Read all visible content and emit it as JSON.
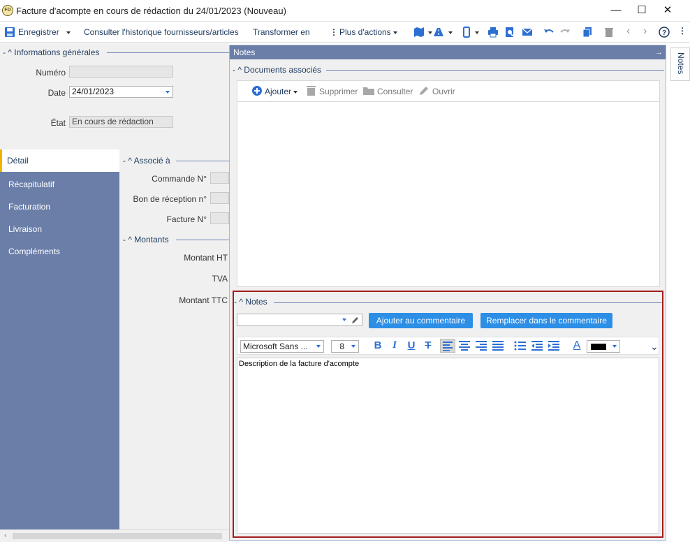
{
  "window": {
    "title": "Facture d'acompte en cours de rédaction du 24/01/2023 (Nouveau)",
    "app_icon_text": "FD",
    "minimize": "—",
    "maximize": "☐",
    "close": "✕"
  },
  "toolbar": {
    "save_label": "Enregistrer",
    "history_label": "Consulter l'historique fournisseurs/articles",
    "transform_label": "Transformer en",
    "more_actions_label": "Plus d'actions"
  },
  "general_info": {
    "header": "Informations générales",
    "numero_label": "Numéro",
    "numero_value": "",
    "date_label": "Date",
    "date_value": "24/01/2023",
    "etat_label": "État",
    "etat_value": "En cours de rédaction"
  },
  "nav": {
    "items": [
      "Détail",
      "Récapitulatif",
      "Facturation",
      "Livraison",
      "Compléments"
    ]
  },
  "associated": {
    "header": "Associé à",
    "commande_label": "Commande N°",
    "bon_label": "Bon de réception n°",
    "facture_label": "Facture N°"
  },
  "amounts": {
    "header": "Montants",
    "ht_label": "Montant HT",
    "tva_label": "TVA",
    "ttc_label": "Montant TTC"
  },
  "notes_panel": {
    "title": "Notes",
    "pin_icon": "→",
    "docs_header": "Documents associés",
    "add_label": "Ajouter",
    "delete_label": "Supprimer",
    "view_label": "Consulter",
    "open_label": "Ouvrir",
    "notes_header": "Notes",
    "add_comment_label": "Ajouter au commentaire",
    "replace_comment_label": "Remplacer dans le commentaire",
    "font_value": "Microsoft Sans ...",
    "size_value": "8",
    "note_text": "Description de la facture d'acompte"
  },
  "vertical_tab": {
    "label": "Notes"
  },
  "colors": {
    "accent": "#2d8ee6",
    "nav_bg": "#6a7ea8",
    "highlight_border": "#a21d1d",
    "active_tab": "#f0b400"
  }
}
